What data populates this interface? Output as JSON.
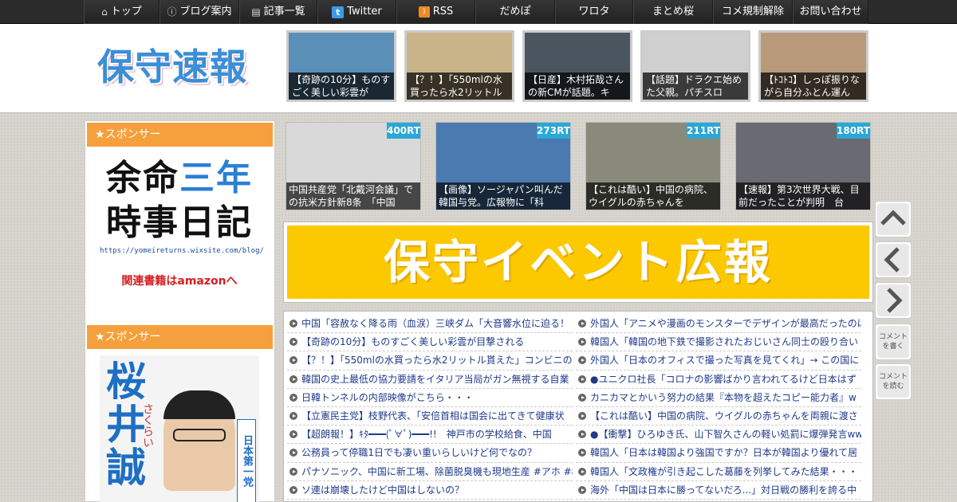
{
  "nav": [
    {
      "label": "トップ",
      "icon": "home-icon",
      "glyph": "⌂"
    },
    {
      "label": "ブログ案内",
      "icon": "info-icon",
      "glyph": "ⓘ"
    },
    {
      "label": "記事一覧",
      "icon": "list-icon",
      "glyph": "▤"
    },
    {
      "label": "Twitter",
      "icon": "twitter-icon",
      "glyph": "t"
    },
    {
      "label": "RSS",
      "icon": "rss-icon",
      "glyph": ")"
    },
    {
      "label": "だめぽ"
    },
    {
      "label": "ワロタ"
    },
    {
      "label": "まとめ桜"
    },
    {
      "label": "コメ規制解除"
    },
    {
      "label": "お問い合わせ"
    }
  ],
  "site": {
    "logo": "保守速報"
  },
  "header_thumbs": [
    {
      "caption": "【奇跡の10分】ものすごく美しい彩雲が",
      "color": "#5a8fb8"
    },
    {
      "caption": "【？！】「550mlの水買ったら水2リットル",
      "color": "#c9b48a"
    },
    {
      "caption": "【日産】木村拓哉さんの新CMが話題。キ",
      "color": "#4a5560"
    },
    {
      "caption": "【話題】ドラクエ始めた父親。パチスロ",
      "color": "#cfcfcf"
    },
    {
      "caption": "【ﾄｺﾄｺ】しっぽ振りながら自分ふとん運ん",
      "color": "#b89a7a"
    }
  ],
  "sidebar": {
    "sponsor_label": "★スポンサー",
    "ad1": {
      "line1a": "余命",
      "line1b": "三年",
      "line2": "時事日記",
      "url": "https://yomeireturns.wixsite.com/blog/",
      "link": "関連書籍はamazonへ"
    },
    "ad2": {
      "name": "桜井誠",
      "kana": "さくらい",
      "party": "日本第一党"
    }
  },
  "rank_thumbs": [
    {
      "badge": "400RT",
      "caption": "中国共産党「北戴河会議」での抗米方針新8条　「中国",
      "color": "#d9d9d9"
    },
    {
      "badge": "273RT",
      "caption": "【画像】ソージャパン叫んだ韓国与党。広報物に「科",
      "color": "#4a7ab0"
    },
    {
      "badge": "211RT",
      "caption": "【これは酷い】中国の病院、ウイグルの赤ちゃんを",
      "color": "#8a8a7a"
    },
    {
      "badge": "180RT",
      "caption": "【速報】第3次世界大戦、目前だったことが判明　台",
      "color": "#6a6a72"
    }
  ],
  "banner": {
    "text": "保守イベント広報"
  },
  "list_left": [
    "中国「容赦なく降る雨（血涙）三峡ダム「大音響水位に迫る！",
    "【奇跡の10分】ものすごく美しい彩雲が目撃される",
    "【？！】「550mlの水買ったら水2リットル貰えた」コンビニの",
    "韓国の史上最低の協力要請をイタリア当局がガン無視する自業",
    "日韓トンネルの内部映像がこちら・・・",
    "【立憲民主党】枝野代表、「安倍首相は国会に出てきて健康状",
    "【超朗報！】ｷﾀ━━━(ﾟ∀ﾟ)━━━!!　神戸市の学校給食、中国",
    "公務員って停職1日でも凄い重いらしいけど何でなの？",
    "パナソニック、中国に新工場、除菌脱臭機も現地生産 #アホ #松",
    "ソ連は崩壊したけど中国はしないの？"
  ],
  "list_right": [
    "外国人「アニメや漫画のモンスターでデザインが最高だったのは",
    "韓国人「韓国の地下鉄で撮影されたおじいさん同士の殴り合い",
    "外国人「日本のオフィスで撮った写真を見てくれ」→ この国に",
    "●ユニクロ社長「コロナの影響ばかり言われてるけど日本はず",
    "カニカマとかいう努力の結果『本物を超えたコピー能力者』w",
    "【これは酷い】中国の病院、ウイグルの赤ちゃんを両親に渡さ",
    "●【衝撃】ひろゆき氏、山下智久さんの軽い処罰に爆弾発言ww",
    "韓国人「日本は韓国より強国ですか？日本が韓国より優れて居",
    "韓国人「文政権が引き起こした葛藤を列挙してみた結果・・・",
    "海外「中国は日本に勝ってないだろ...」対日戦の勝利を誇る中"
  ],
  "float_buttons": [
    {
      "name": "scroll-top-button",
      "icon": "chevron-up-icon",
      "label": ""
    },
    {
      "name": "back-button",
      "icon": "chevron-left-icon",
      "label": ""
    },
    {
      "name": "forward-button",
      "icon": "chevron-right-icon",
      "label": ""
    },
    {
      "name": "write-comment-button",
      "icon": "",
      "label": "コメントを書く"
    },
    {
      "name": "read-comment-button",
      "icon": "",
      "label": "コメントを読む"
    }
  ]
}
